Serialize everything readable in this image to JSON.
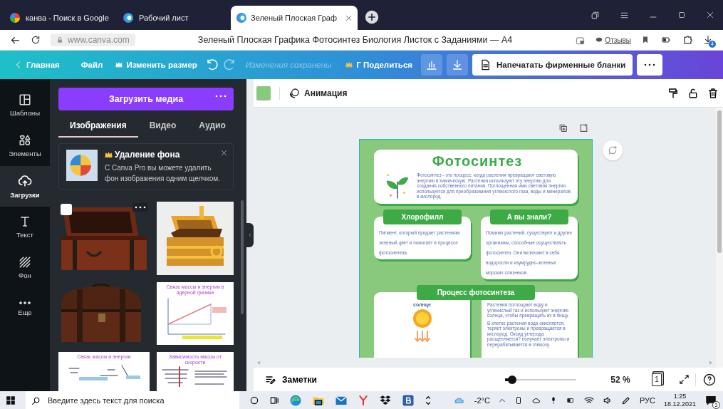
{
  "browser": {
    "tabs": [
      {
        "kind": "google",
        "title": "канва - Поиск в Google",
        "selected": false
      },
      {
        "kind": "canva",
        "title": "Рабочий лист",
        "selected": false
      },
      {
        "kind": "canva",
        "title": "Зеленый Плоская Граф",
        "selected": true
      }
    ],
    "url": "www.canva.com",
    "page_title": "Зеленый Плоская Графика Фотосинтез Биология Листок с Заданиями — А4",
    "feedback": "Отзывы",
    "downloads_badge": "4"
  },
  "editor_bar": {
    "home": "Главная",
    "file": "Файл",
    "resize": "Изменить размер",
    "status": "Изменения сохранены",
    "share": "Г Поделиться",
    "print": "Напечатать фирменные бланки"
  },
  "rail": [
    {
      "kind": "templates",
      "label": "Шаблоны",
      "selected": false
    },
    {
      "kind": "elements",
      "label": "Элементы",
      "selected": false
    },
    {
      "kind": "uploads",
      "label": "Загрузки",
      "selected": true
    },
    {
      "kind": "text",
      "label": "Текст",
      "selected": false
    },
    {
      "kind": "background",
      "label": "Фон",
      "selected": false
    },
    {
      "kind": "more",
      "label": "Еще",
      "selected": false
    }
  ],
  "panel": {
    "upload": "Загрузить медиа",
    "tabs": [
      {
        "label": "Изображения",
        "selected": true
      },
      {
        "label": "Видео",
        "selected": false
      },
      {
        "label": "Аудио",
        "selected": false
      }
    ],
    "promo": {
      "title": "Удаление фона",
      "text": "С Canva Pro вы можете удалить фон изображения одним щелчком."
    },
    "thumbnails": [
      {
        "kind": "picture",
        "hovered": true,
        "checked": false
      },
      {
        "kind": "picture",
        "hovered": false
      },
      {
        "kind": "picture",
        "hovered": false
      },
      {
        "kind": "slide",
        "title": "Связь массы и энергии в ядерной физике",
        "hovered": false
      },
      {
        "kind": "slide",
        "title": "Связь массы и энергии",
        "hovered": false
      },
      {
        "kind": "slide",
        "title": "Зависимость массы от скорости",
        "hovered": false
      }
    ]
  },
  "toolbar": {
    "animate": "Анимация"
  },
  "document": {
    "title": "Фотосинтез",
    "intro": "Фотосинтез - это процесс, когда растения превращают световую энергию в химическую. Растения используют эту энергию для создания собственного питания. Поглощенная ими световая энергия используется для преобразования углекислого газа, воды и минералов в кислород.",
    "cards": [
      {
        "heading": "Хлорофилл",
        "text": "Пигмент, который придает растениям зеленый цвет и помогает в процессе фотосинтеза."
      },
      {
        "heading": "А вы знали?",
        "text": "Помимо растений, существуют и другие организмы, способные осуществлять фотосинтез. Они включают в себя водоросли и изумрудно-зеленых морских слизнеков."
      }
    ],
    "process": {
      "heading": "Процесс фотосинтеза",
      "sun_label": "солнце",
      "paragraphs": [
        "Растения поглощают воду и углекислый газ и используют энергию солнца, чтобы превращать их в пищу.",
        "В клетке растения вода окисляется, теряет электроны и превращается в кислород. Оксид углерода расщепляется? получает электроны и перерабатывается в глюкозу."
      ]
    }
  },
  "bottom": {
    "notes": "Заметки",
    "zoom": "52 %",
    "level": 0.05,
    "page": "1"
  },
  "taskbar": {
    "search_placeholder": "Введите здесь текст для поиска",
    "temperature": "-2°C",
    "language": "РУС",
    "time": "1:25",
    "date": "18.12.2021",
    "notifications": "3"
  }
}
